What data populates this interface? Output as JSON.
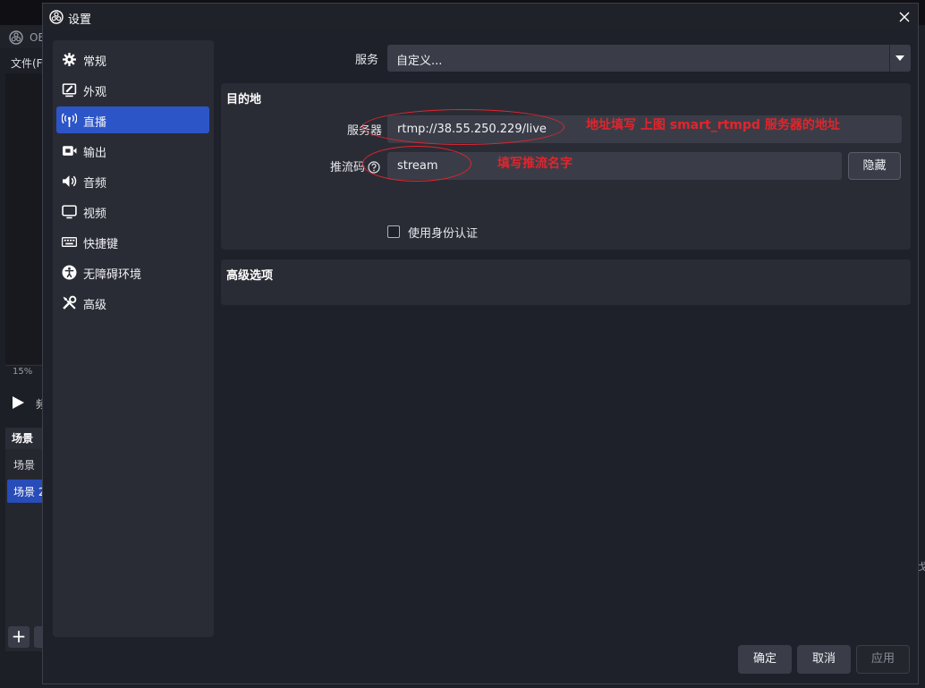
{
  "background": {
    "title": "OE",
    "menu_file": "文件(F",
    "zoom": "15%",
    "play_label": "频",
    "scenes_title": "场景",
    "scenes": [
      "场景",
      "场景 2"
    ],
    "right_mark": "戈"
  },
  "dialog": {
    "title": "设置"
  },
  "sidebar": {
    "items": [
      {
        "label": "常规",
        "icon": "gear-icon",
        "active": false
      },
      {
        "label": "外观",
        "icon": "appearance-icon",
        "active": false
      },
      {
        "label": "直播",
        "icon": "antenna-icon",
        "active": true
      },
      {
        "label": "输出",
        "icon": "output-icon",
        "active": false
      },
      {
        "label": "音频",
        "icon": "speaker-icon",
        "active": false
      },
      {
        "label": "视频",
        "icon": "monitor-icon",
        "active": false
      },
      {
        "label": "快捷键",
        "icon": "keyboard-icon",
        "active": false
      },
      {
        "label": "无障碍环境",
        "icon": "accessibility-icon",
        "active": false
      },
      {
        "label": "高级",
        "icon": "tools-icon",
        "active": false
      }
    ]
  },
  "stream": {
    "service_label": "服务",
    "service_value": "自定义...",
    "destination": {
      "title": "目的地",
      "server_label": "服务器",
      "server_value": "rtmp://38.55.250.229/live",
      "key_label": "推流码",
      "key_value": "stream",
      "hide_button": "隐藏",
      "auth_label": "使用身份认证",
      "auth_checked": false
    },
    "advanced_title": "高级选项"
  },
  "annotations": {
    "server_note": "地址填写 上图 smart_rtmpd 服务器的地址",
    "key_note": "填写推流名字",
    "color": "#e3242b"
  },
  "footer": {
    "ok": "确定",
    "cancel": "取消",
    "apply": "应用"
  },
  "colors": {
    "accent": "#2c55c8",
    "panel": "#2a2c35",
    "input": "#3a3d48"
  }
}
